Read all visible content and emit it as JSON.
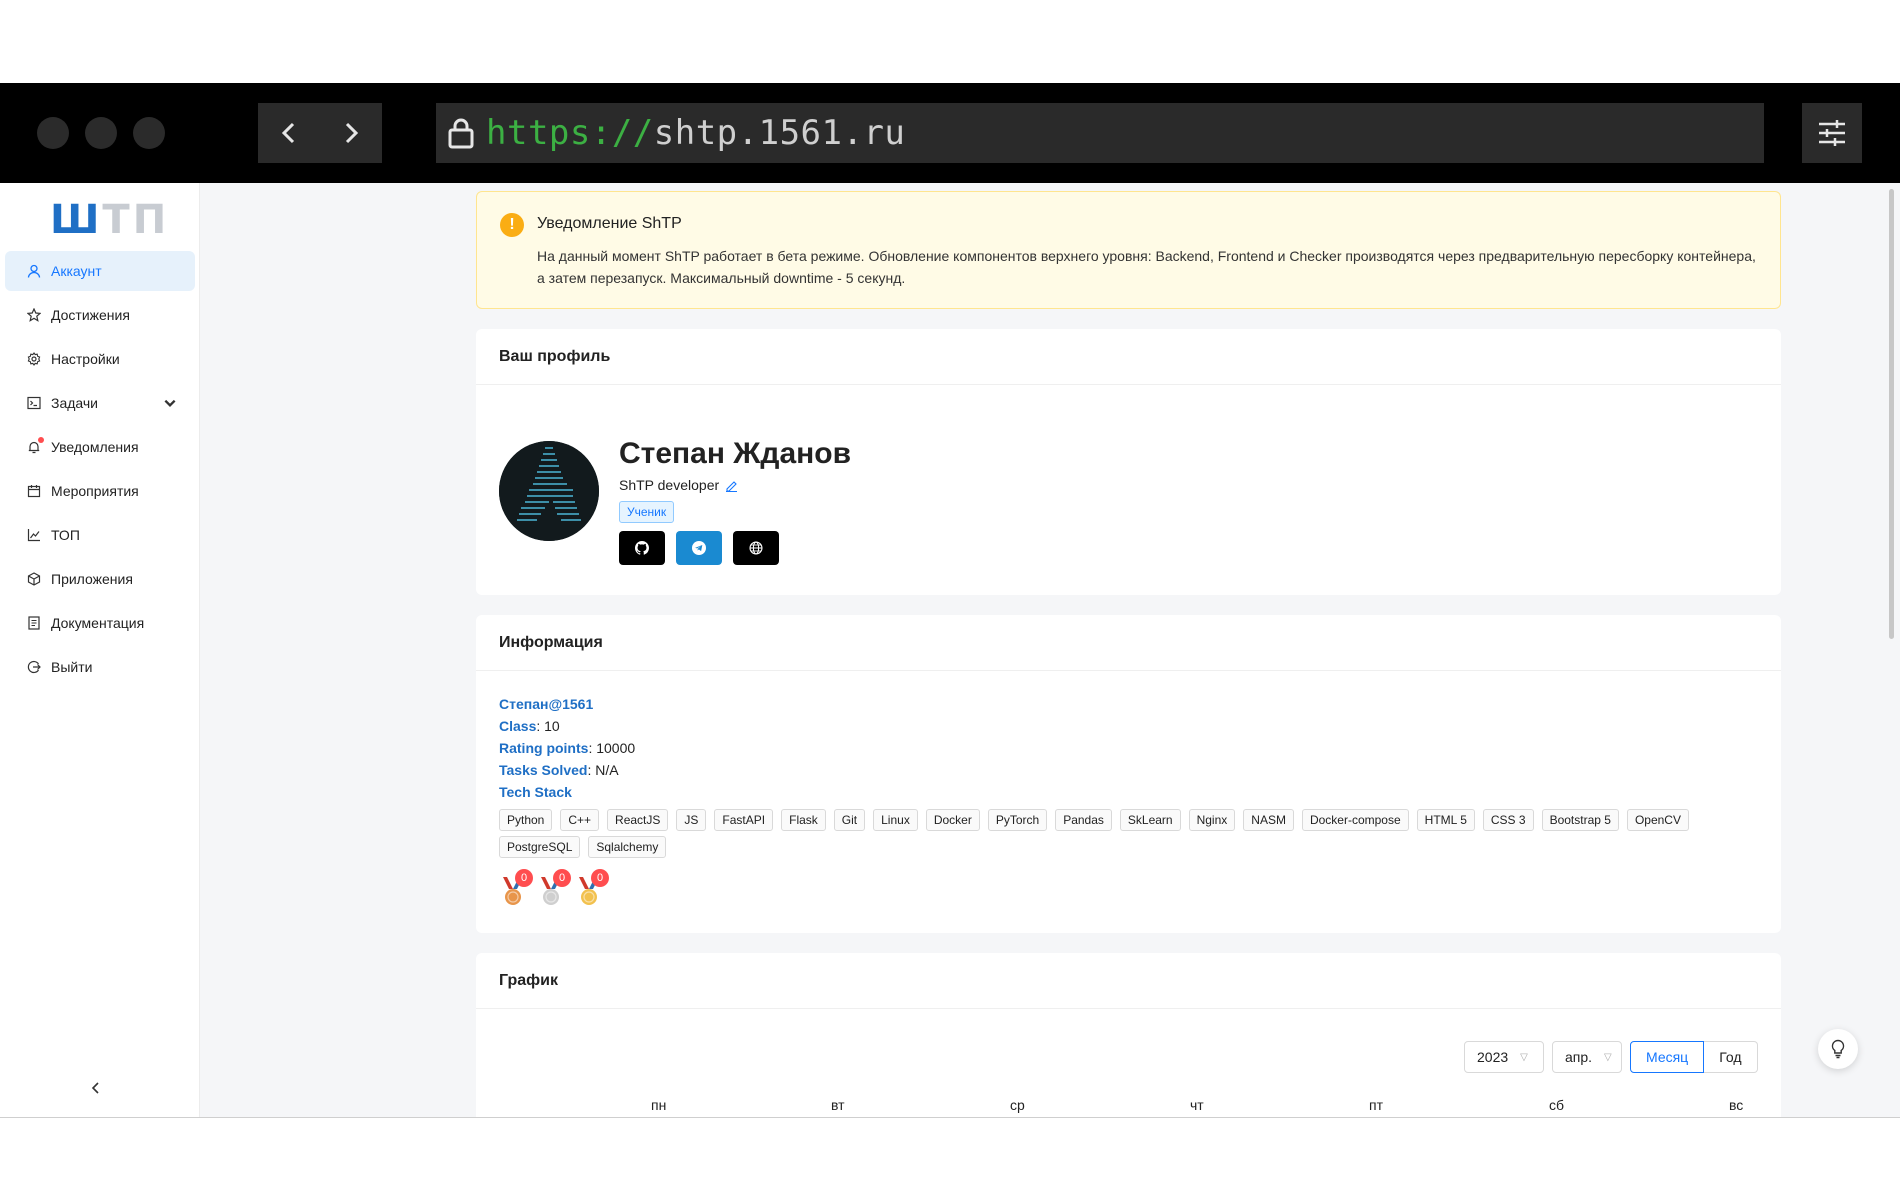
{
  "browser": {
    "url_protocol": "https://",
    "url_host": "shtp.1561.ru"
  },
  "logo": {
    "left": "Ш",
    "right": "ТП"
  },
  "sidebar": {
    "items": [
      {
        "label": "Аккаунт",
        "icon": "user-icon",
        "active": true
      },
      {
        "label": "Достижения",
        "icon": "star-icon"
      },
      {
        "label": "Настройки",
        "icon": "gear-icon"
      },
      {
        "label": "Задачи",
        "icon": "terminal-icon",
        "has_submenu": true
      },
      {
        "label": "Уведомления",
        "icon": "bell-icon",
        "has_dot": true
      },
      {
        "label": "Мероприятия",
        "icon": "calendar-icon"
      },
      {
        "label": "ТОП",
        "icon": "line-chart-icon"
      },
      {
        "label": "Приложения",
        "icon": "cube-icon"
      },
      {
        "label": "Документация",
        "icon": "document-icon"
      },
      {
        "label": "Выйти",
        "icon": "logout-icon"
      }
    ]
  },
  "alert": {
    "title": "Уведомление ShTP",
    "text": "На данный момент ShTP работает в бета режиме. Обновление компонентов верхнего уровня: Backend, Frontend и Checker производятся через предварительную пересборку контейнера, а затем перезапуск. Максимальный downtime - 5 секунд."
  },
  "profile": {
    "header": "Ваш профиль",
    "name": "Степан Жданов",
    "role": "ShTP developer",
    "badge": "Ученик",
    "social": [
      "github-icon",
      "telegram-icon",
      "globe-icon"
    ]
  },
  "info": {
    "header": "Информация",
    "username_first": "Степан",
    "username_rest": "@1561",
    "class_label": "Class",
    "class_value": "10",
    "rating_label": "Rating points",
    "rating_value": "10000",
    "tasks_label": "Tasks Solved",
    "tasks_value": "N/A",
    "stack_label": "Tech Stack",
    "tags": [
      "Python",
      "C++",
      "ReactJS",
      "JS",
      "FastAPI",
      "Flask",
      "Git",
      "Linux",
      "Docker",
      "PyTorch",
      "Pandas",
      "SkLearn",
      "Nginx",
      "NASM",
      "Docker-compose",
      "HTML 5",
      "CSS 3",
      "Bootstrap 5",
      "OpenCV",
      "PostgreSQL",
      "Sqlalchemy"
    ],
    "medals": [
      {
        "name": "bronze",
        "color": "#e8954a",
        "count": "0"
      },
      {
        "name": "silver",
        "color": "#cfcfcf",
        "count": "0"
      },
      {
        "name": "gold",
        "color": "#f2c14e",
        "count": "0"
      }
    ]
  },
  "graph": {
    "header": "График",
    "year": "2023",
    "month": "апр.",
    "mode_month": "Месяц",
    "mode_year": "Год",
    "days": [
      "пн",
      "вт",
      "ср",
      "чт",
      "пт",
      "сб",
      "вс"
    ]
  }
}
